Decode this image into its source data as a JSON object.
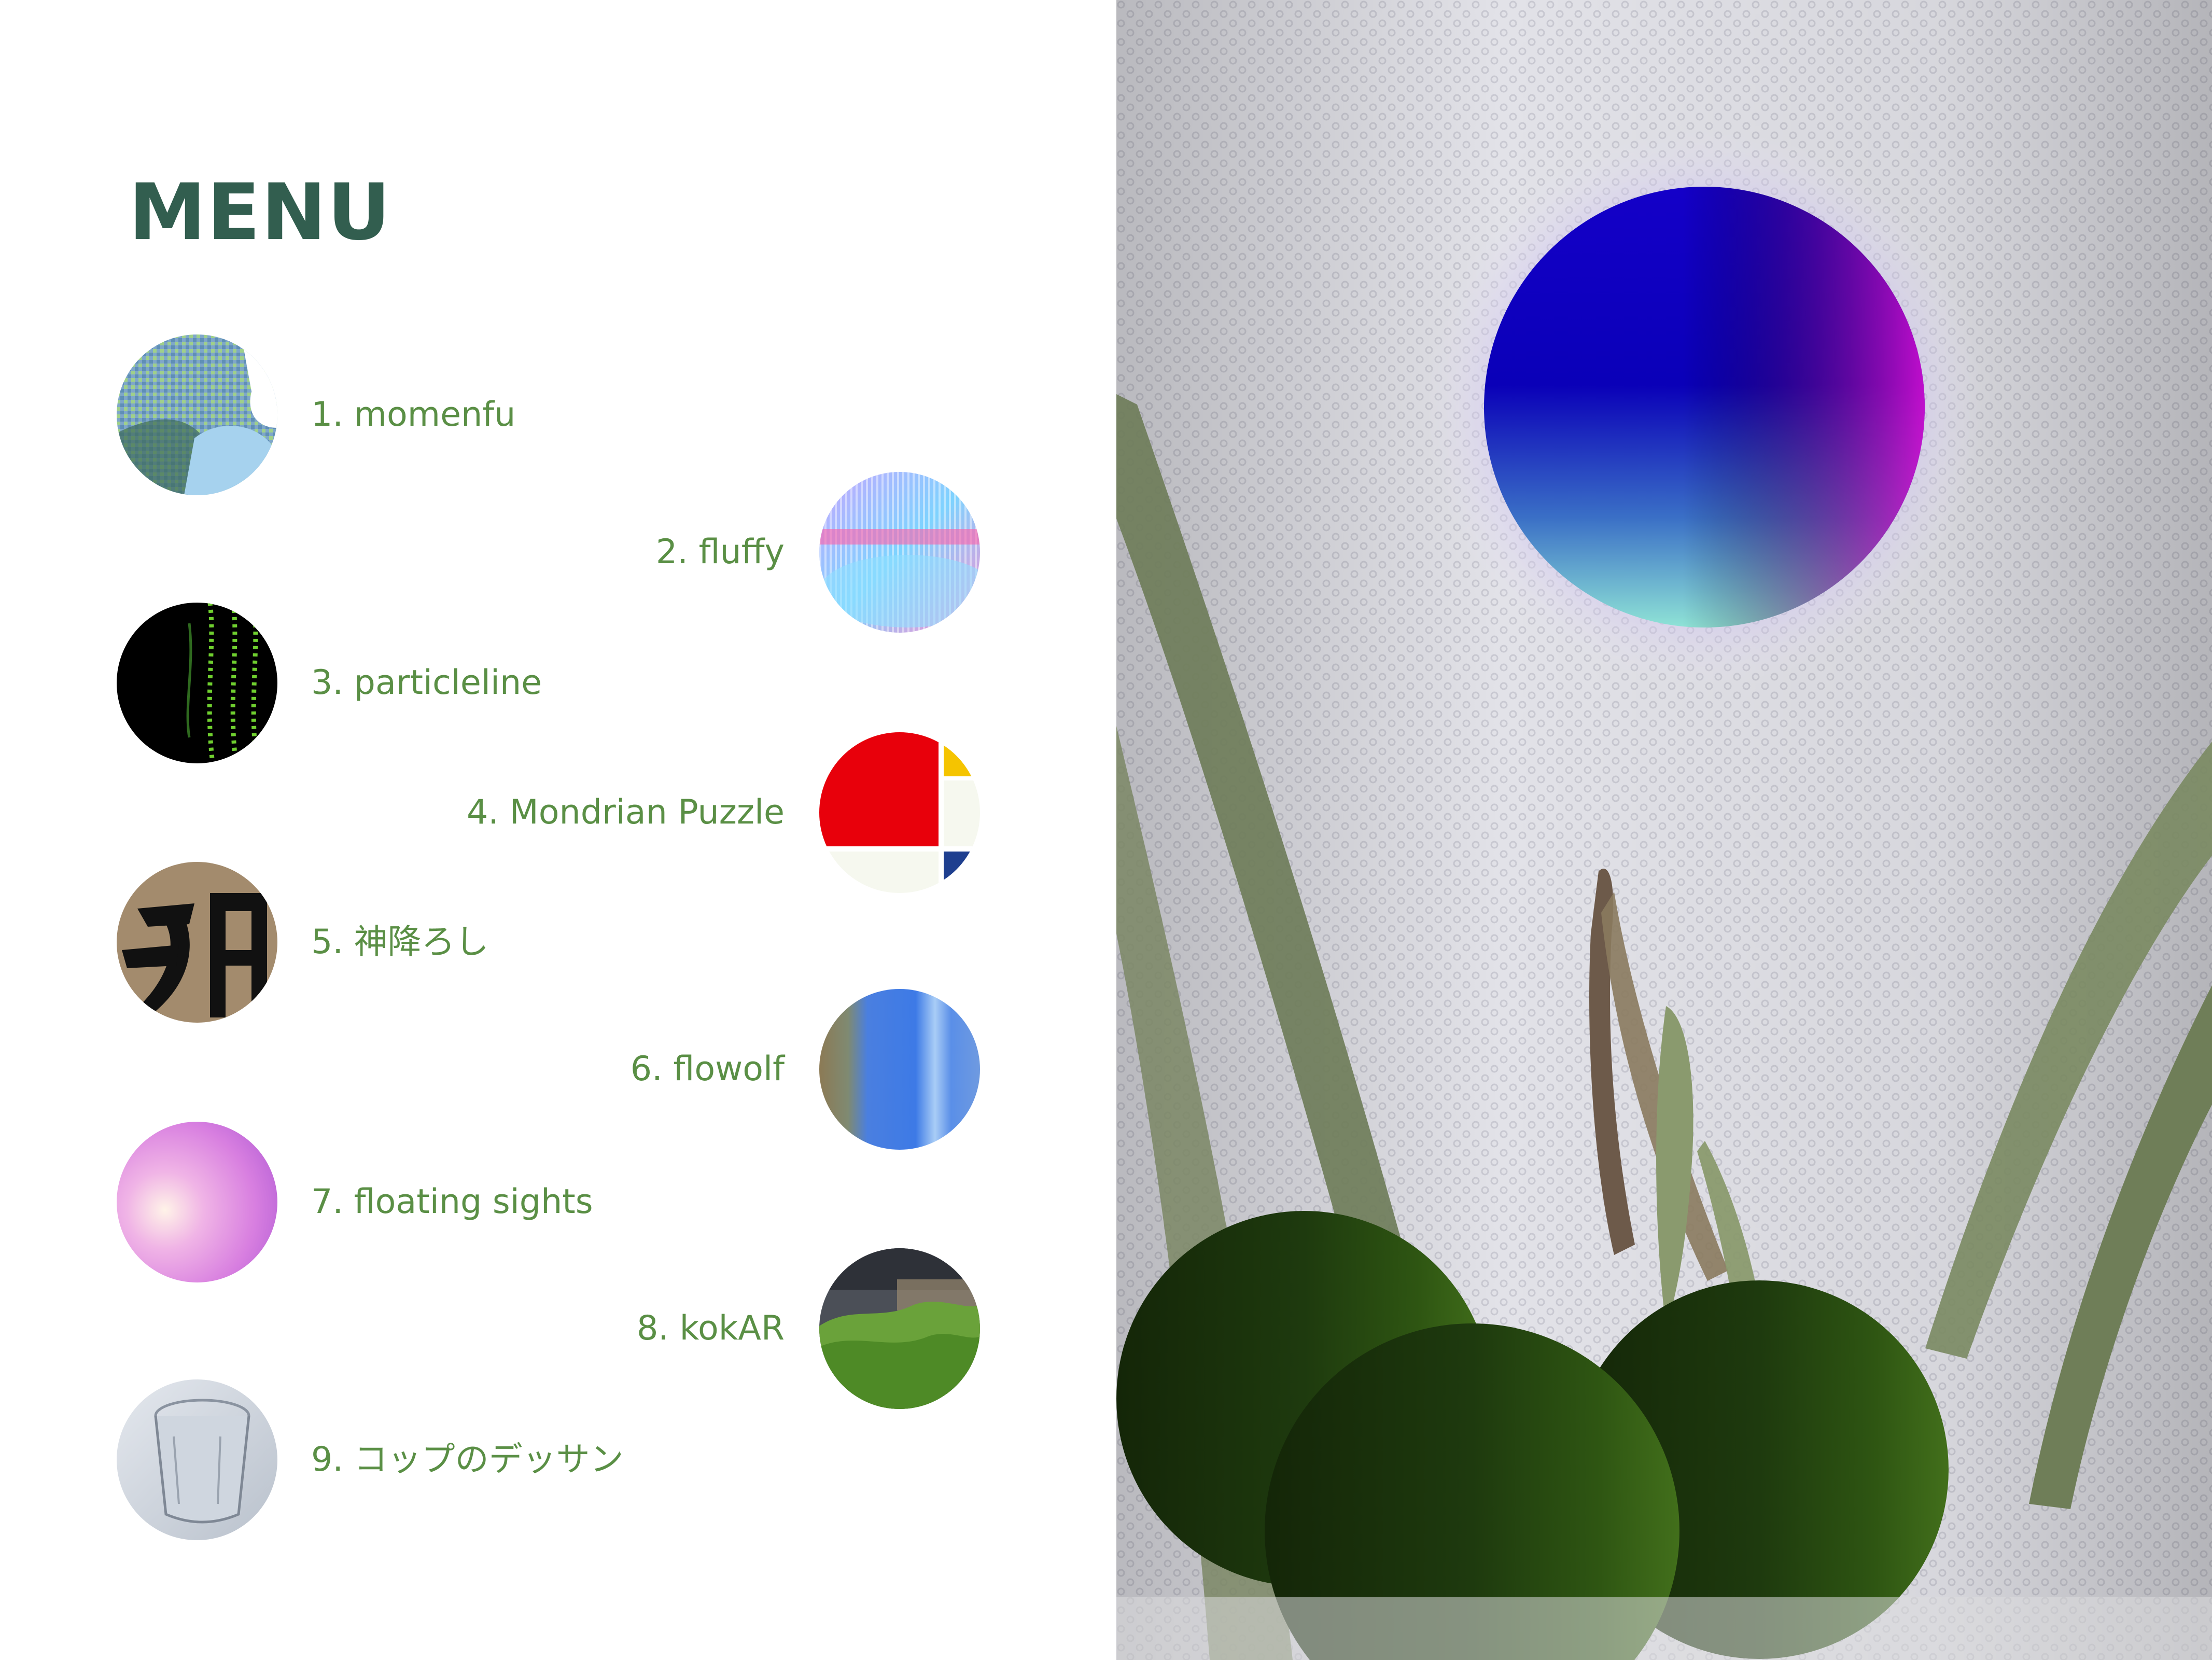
{
  "menu": {
    "title": "MENU",
    "items": [
      {
        "label": "1. momenfu",
        "icon": "momenfu-thumbnail"
      },
      {
        "label": "2. fluffy",
        "icon": "fluffy-thumbnail"
      },
      {
        "label": "3. particleline",
        "icon": "particleline-thumbnail"
      },
      {
        "label": "4. Mondrian Puzzle",
        "icon": "mondrian-puzzle-thumbnail"
      },
      {
        "label": "5. 神降ろし",
        "icon": "kami-oroshi-thumbnail"
      },
      {
        "label": "6. flowolf",
        "icon": "flowolf-thumbnail"
      },
      {
        "label": "7. floating sights",
        "icon": "floating-sights-thumbnail"
      },
      {
        "label": "8. kokAR",
        "icon": "kokar-thumbnail"
      },
      {
        "label": "9. コップのデッサン",
        "icon": "cup-drawing-thumbnail"
      }
    ]
  },
  "colors": {
    "title": "#325e4f",
    "item_label": "#5a8f45",
    "background": "#ffffff"
  },
  "preview": {
    "description_icon": "ar-camera-preview"
  }
}
